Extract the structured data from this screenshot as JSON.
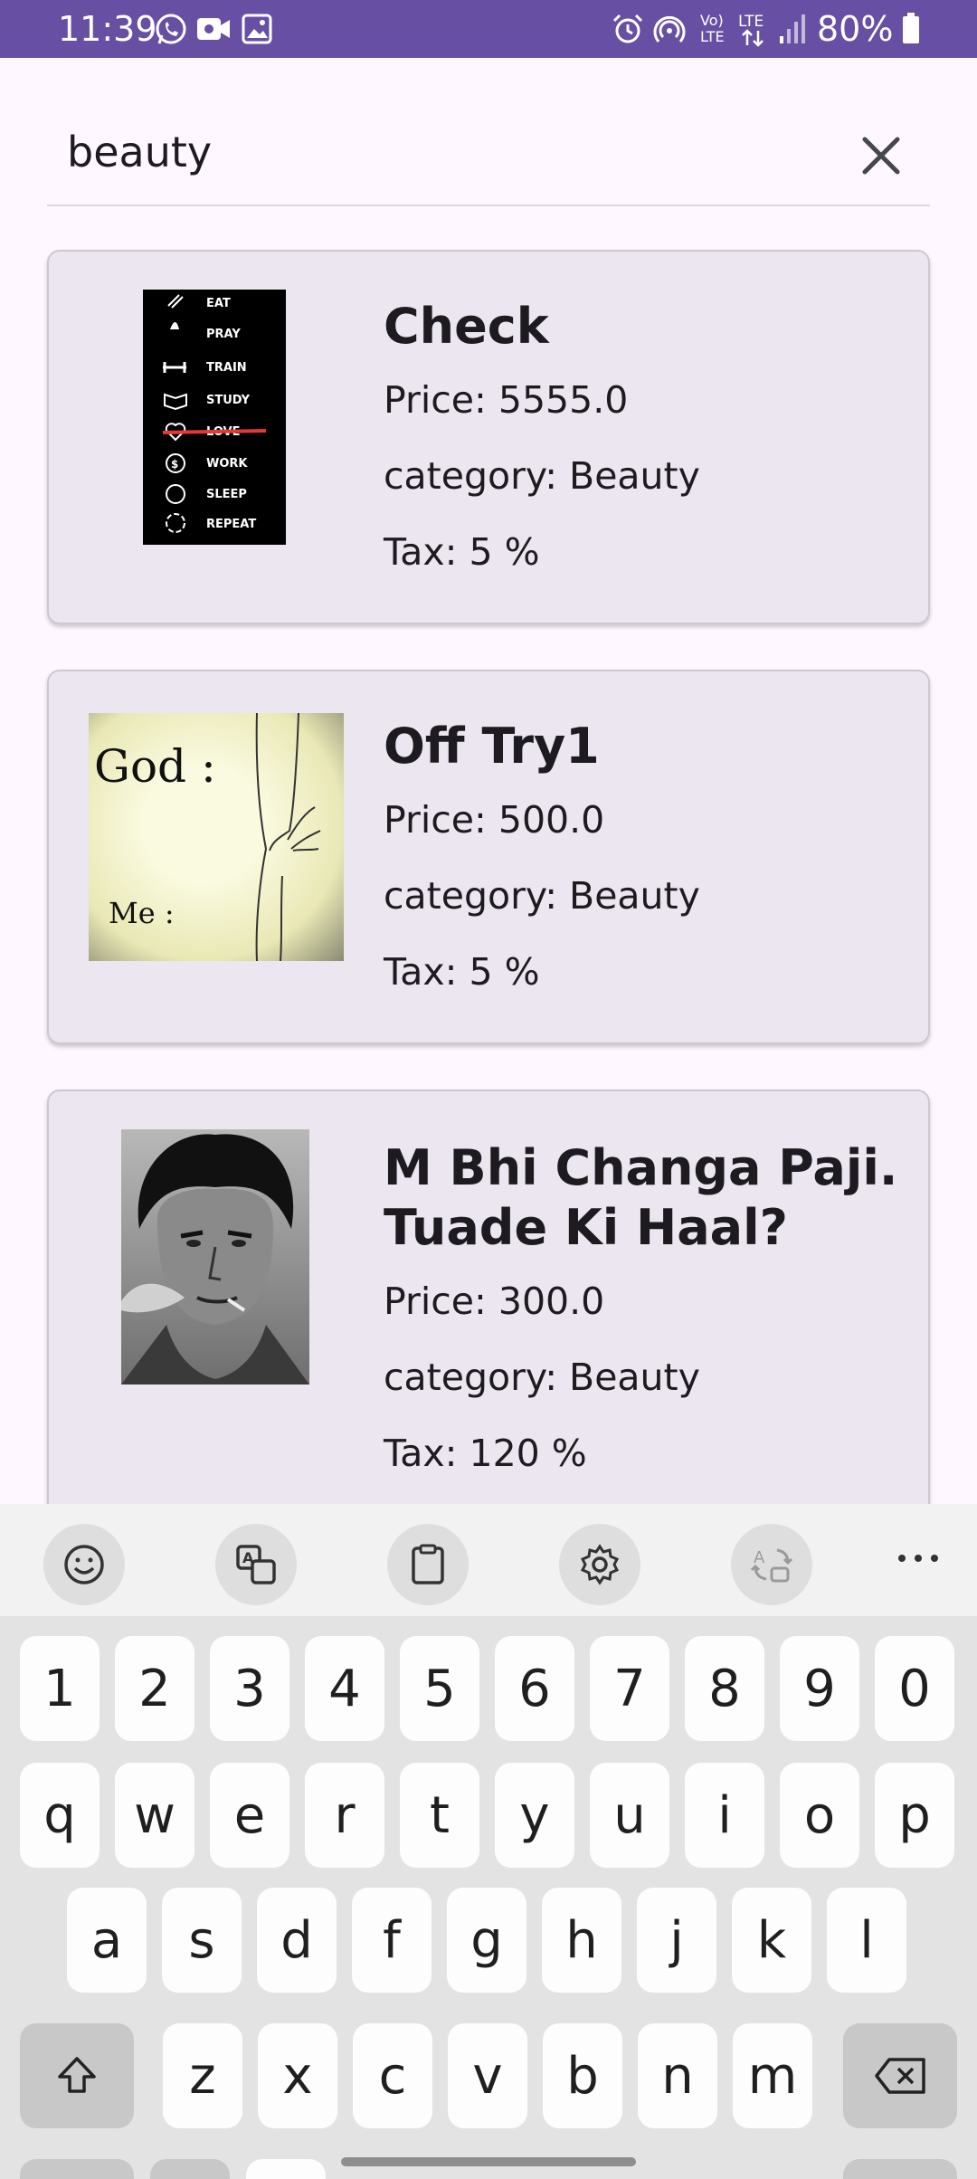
{
  "status_bar": {
    "time": "11:39",
    "battery_text": "80%",
    "left_icons": [
      "whatsapp-icon",
      "video-call-icon",
      "gallery-icon"
    ],
    "right_icons": [
      "alarm-icon",
      "hotspot-icon",
      "volte-icon",
      "lte-icon",
      "signal-icon",
      "battery-icon"
    ],
    "volte_label": "Vo)\nLTE",
    "lte_label": "LTE"
  },
  "search": {
    "value": "beauty",
    "clear_icon": "close-icon"
  },
  "products": [
    {
      "title": "Check",
      "price": "Price: 5555.0",
      "category": "category: Beauty",
      "tax": "Tax: 5 %",
      "image": "eat-pray-train-poster",
      "poster_lines": [
        "EAT",
        "PRAY",
        "TRAIN",
        "STUDY",
        "LOVE",
        "WORK",
        "SLEEP",
        "REPEAT"
      ]
    },
    {
      "title": "Off Try1",
      "price": "Price: 500.0",
      "category": "category: Beauty",
      "tax": "Tax: 5 %",
      "image": "god-me-meme",
      "meme_top": "God :",
      "meme_bottom": "Me :"
    },
    {
      "title": "M Bhi Changa Paji. Tuade Ki Haal?",
      "price": "Price: 300.0",
      "category": "category: Beauty",
      "tax": "Tax: 120 %",
      "image": "smoking-man-portrait"
    }
  ],
  "keyboard": {
    "toolbar": [
      "emoji-icon",
      "translate-icon",
      "clipboard-icon",
      "settings-icon",
      "text-swap-icon",
      "more-icon"
    ],
    "row_numbers": [
      "1",
      "2",
      "3",
      "4",
      "5",
      "6",
      "7",
      "8",
      "9",
      "0"
    ],
    "row_top": [
      "q",
      "w",
      "e",
      "r",
      "t",
      "y",
      "u",
      "i",
      "o",
      "p"
    ],
    "row_middle": [
      "a",
      "s",
      "d",
      "f",
      "g",
      "h",
      "j",
      "k",
      "l"
    ],
    "row_bottom": [
      "z",
      "x",
      "c",
      "v",
      "b",
      "n",
      "m"
    ]
  },
  "colors": {
    "app_bar": "#6750a4",
    "background": "#fef7ff",
    "card": "#ece6f0",
    "keyboard": "#e3e3e3"
  }
}
